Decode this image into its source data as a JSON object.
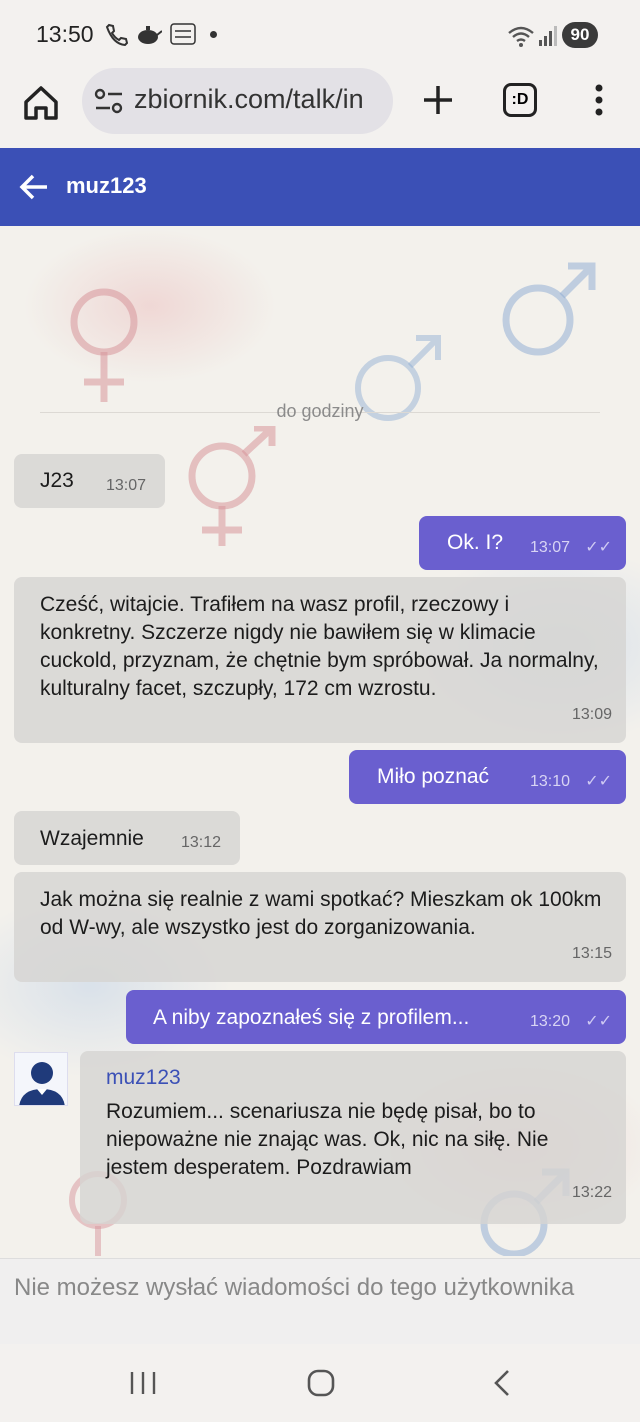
{
  "status_bar": {
    "time": "13:50",
    "battery": "90",
    "icons": [
      "phone-icon",
      "teapot-icon",
      "temu-icon",
      "dot-icon",
      "wifi-icon",
      "signal-icon"
    ]
  },
  "browser": {
    "url": "zbiornik.com/talk/in",
    "tab_label": ":D"
  },
  "header": {
    "title": "muz123"
  },
  "chat": {
    "separator": "do godziny",
    "messages": [
      {
        "side": "in",
        "text": "J23",
        "time": "13:07"
      },
      {
        "side": "out",
        "text": "Ok. I?",
        "time": "13:07"
      },
      {
        "side": "in",
        "text": "Cześć, witajcie. Trafiłem na wasz profil, rzeczowy i konkretny. Szczerze nigdy nie bawiłem się w klimacie cuckold, przyznam, że chętnie bym spróbował. Ja normalny, kulturalny facet, szczupły, 172 cm wzrostu.",
        "time": "13:09"
      },
      {
        "side": "out",
        "text": "Miło poznać",
        "time": "13:10"
      },
      {
        "side": "in",
        "text": "Wzajemnie",
        "time": "13:12"
      },
      {
        "side": "in",
        "text": "Jak można się realnie z wami spotkać? Mieszkam ok 100km od W-wy, ale wszystko jest do zorganizowania.",
        "time": "13:15"
      },
      {
        "side": "out",
        "text": "A niby zapoznałeś się z profilem...",
        "time": "13:20"
      },
      {
        "side": "in",
        "name": "muz123",
        "text": "Rozumiem... scenariusza nie będę pisał, bo to niepoważne nie znając was. Ok, nic na siłę. Nie jestem desperatem. Pozdrawiam",
        "time": "13:22"
      }
    ]
  },
  "footer": {
    "notice": "Nie możesz wysłać wiadomości do tego użytkownika"
  },
  "colors": {
    "header": "#3b50b6",
    "outgoing": "#6a5fcf",
    "incoming": "#d6d4d2"
  }
}
